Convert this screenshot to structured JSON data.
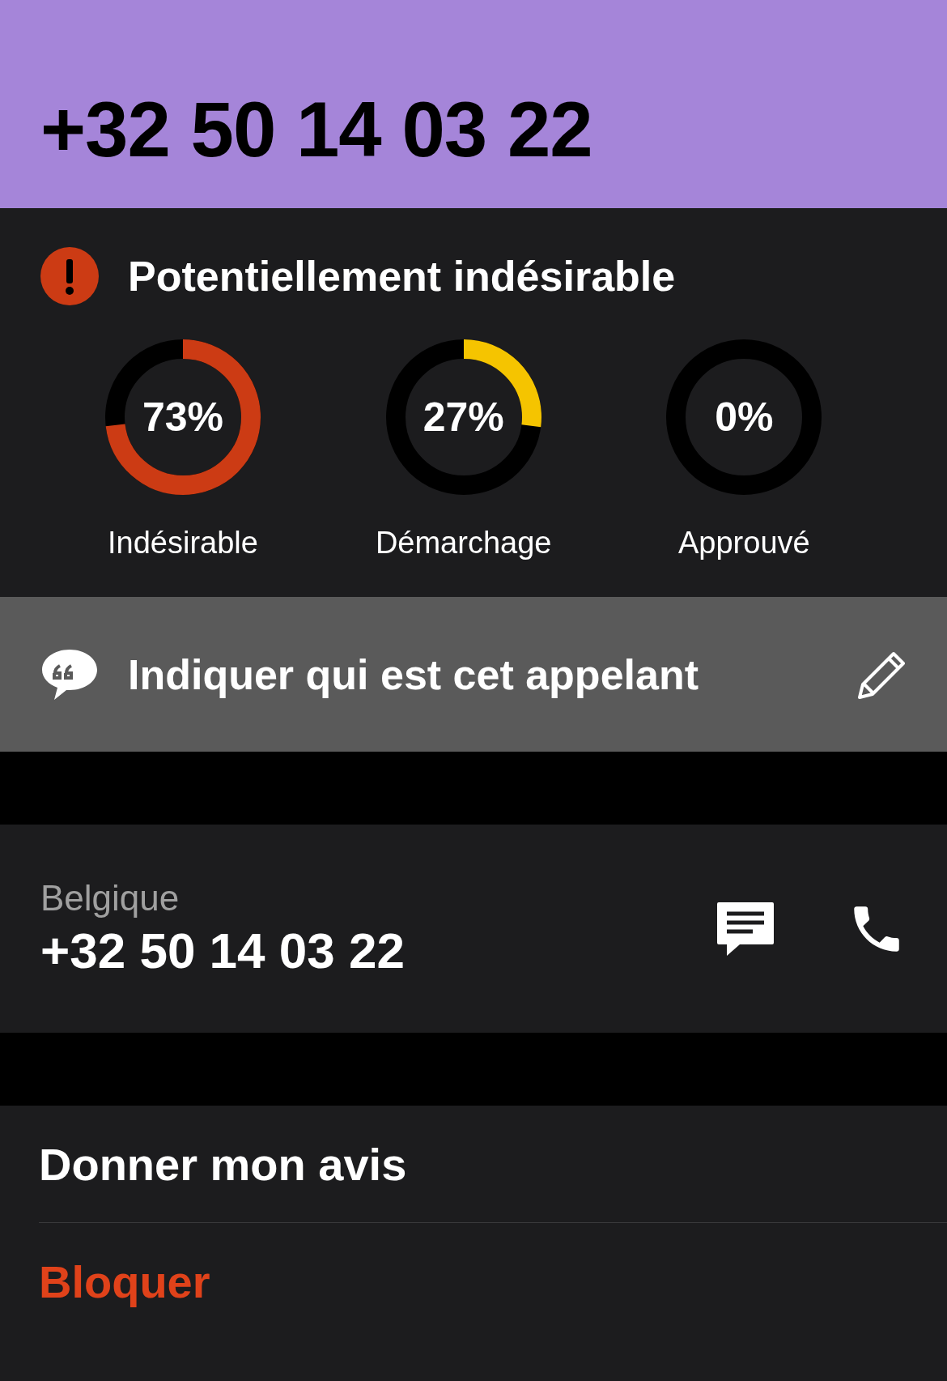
{
  "header": {
    "title": "+32 50 14 03 22"
  },
  "verdict": {
    "title": "Potentiellement indésirable",
    "meters": [
      {
        "reading": "73%",
        "label": "Indésirable",
        "color": "#cc3b14"
      },
      {
        "reading": "27%",
        "label": "Démarchage",
        "color": "#f5c400"
      },
      {
        "reading": "0%",
        "label": "Approuvé"
      }
    ]
  },
  "caller_id": {
    "label": "Indiquer qui est cet appelant"
  },
  "contact": {
    "country": "Belgique",
    "number": "+32 50 14 03 22"
  },
  "actions": [
    {
      "label": "Donner mon avis",
      "kind": "normal"
    },
    {
      "label": "Bloquer",
      "kind": "destructive"
    }
  ]
}
